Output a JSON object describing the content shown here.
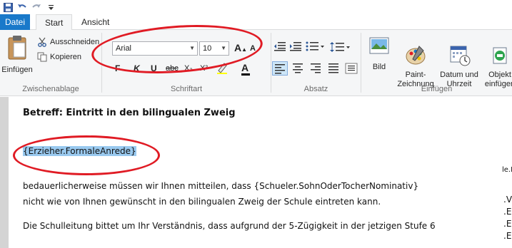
{
  "tabs": {
    "file": "Datei",
    "start": "Start",
    "view": "Ansicht"
  },
  "clipboard": {
    "paste_label": "Einfügen",
    "cut_label": "Ausschneiden",
    "copy_label": "Kopieren",
    "group_label": "Zwischenablage"
  },
  "font": {
    "family_value": "Arial",
    "size_value": "10",
    "grow_label": "A",
    "shrink_label": "A",
    "bold_label": "F",
    "italic_label": "K",
    "underline_label": "U",
    "strike_label": "abc",
    "subscript_label": "X₂",
    "superscript_label": "X²",
    "color_label": "A",
    "group_label": "Schriftart"
  },
  "paragraph": {
    "group_label": "Absatz"
  },
  "insert": {
    "picture_label": "Bild",
    "paint_label": "Paint-\nZeichnung",
    "datetime_label": "Datum und\nUhrzeit",
    "object_label": "Objekt\neinfügen",
    "group_label": "Einfügen"
  },
  "document": {
    "subject": "Betreff: Eintritt in den bilingualen  Zweig",
    "salutation": "{Erzieher.FormaleAnrede}",
    "line1": "bedauerlicherweise müssen wir Ihnen mitteilen, dass {Schueler.SohnOderTocherNominativ}",
    "line2": "nicht wie von Ihnen gewünscht in den bilingualen Zweig der Schule eintreten kann.",
    "line3": "Die Schulleitung bittet um Ihr Verständnis, dass aufgrund der 5-Zügigkeit in der jetzigen Stufe 6"
  },
  "side_panel": {
    "item1": "le.B",
    "item2": ".V",
    "item3": ".E",
    "item4": ".E",
    "item5": ".E"
  },
  "colors": {
    "file_tab": "#1979ca",
    "highlight": "#99c9ef",
    "annotation": "#e01b24"
  }
}
